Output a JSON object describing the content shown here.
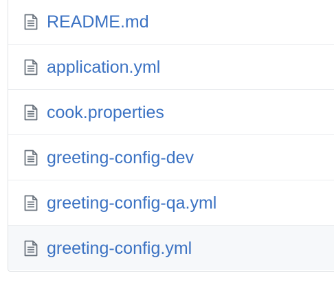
{
  "files": [
    {
      "name": "README.md",
      "icon": "file-text-icon"
    },
    {
      "name": "application.yml",
      "icon": "file-text-icon"
    },
    {
      "name": "cook.properties",
      "icon": "file-text-icon"
    },
    {
      "name": "greeting-config-dev",
      "icon": "file-text-icon"
    },
    {
      "name": "greeting-config-qa.yml",
      "icon": "file-text-icon"
    },
    {
      "name": "greeting-config.yml",
      "icon": "file-text-icon",
      "highlighted": true
    }
  ],
  "colors": {
    "link": "#3b72c3",
    "icon": "#6a737d",
    "row_border": "#eaecef",
    "highlight_bg": "#f6f8fa"
  }
}
